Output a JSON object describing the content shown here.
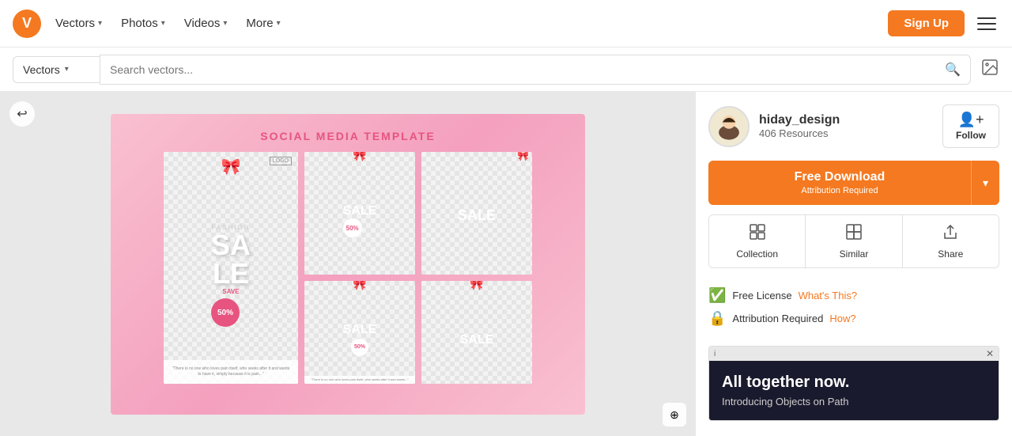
{
  "site": {
    "logo_letter": "V"
  },
  "nav": {
    "items": [
      {
        "label": "Vectors",
        "id": "vectors"
      },
      {
        "label": "Photos",
        "id": "photos"
      },
      {
        "label": "Videos",
        "id": "videos"
      },
      {
        "label": "More",
        "id": "more"
      }
    ],
    "signup_label": "Sign Up"
  },
  "search": {
    "category": "Vectors",
    "placeholder": "Search vectors...",
    "image_search_title": "Search by image"
  },
  "author": {
    "name": "hiday_design",
    "resources": "406 Resources",
    "follow_label": "Follow"
  },
  "download": {
    "primary_label": "Free Download",
    "sub_label": "Attribution Required",
    "dropdown_icon": "▾"
  },
  "actions": [
    {
      "label": "Collection",
      "icon": "⊞",
      "id": "collection"
    },
    {
      "label": "Similar",
      "icon": "⧉",
      "id": "similar"
    },
    {
      "label": "Share",
      "icon": "↑",
      "id": "share"
    }
  ],
  "license": {
    "free_label": "Free License",
    "free_link": "What's This?",
    "attribution_label": "Attribution Required",
    "attribution_link": "How?"
  },
  "template": {
    "title": "SOCIAL MEDIA TEMPLATE",
    "sale_main": "SALE",
    "fashion": "FASHION",
    "save": "SAVE",
    "percent": "50%"
  },
  "ad": {
    "info_label": "i",
    "close_label": "✕",
    "headline": "All together now.",
    "sub": "Introducing Objects on Path"
  }
}
